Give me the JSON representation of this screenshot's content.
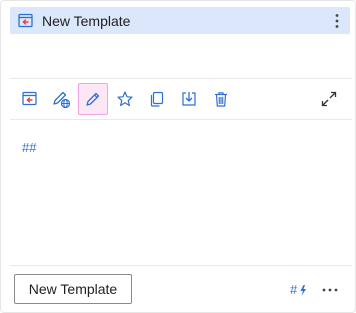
{
  "header": {
    "title": "New Template",
    "icon": "template-icon",
    "menu_icon": "more-vertical-icon"
  },
  "toolbar": {
    "buttons": [
      {
        "name": "insert-template-button",
        "icon": "insert-template-icon"
      },
      {
        "name": "edit-visibility-button",
        "icon": "edit-globe-icon"
      },
      {
        "name": "edit-button",
        "icon": "pencil-icon",
        "active": true
      },
      {
        "name": "favorite-button",
        "icon": "star-icon"
      },
      {
        "name": "duplicate-button",
        "icon": "copy-icon"
      },
      {
        "name": "import-button",
        "icon": "download-into-icon"
      },
      {
        "name": "delete-button",
        "icon": "trash-icon"
      }
    ],
    "expand_icon": "expand-icon"
  },
  "content": {
    "text": "##"
  },
  "footer": {
    "new_template_label": "New Template",
    "macro_icon": "hash-lightning-icon",
    "more_icon": "more-horizontal-icon"
  },
  "colors": {
    "accent": "#2f6fd1",
    "header_bg": "#dbe7fb",
    "active_bg": "#fde7f7",
    "active_border": "#e9a6e0",
    "icon_blue": "#2f6fd1",
    "template_red": "#e8423f"
  }
}
